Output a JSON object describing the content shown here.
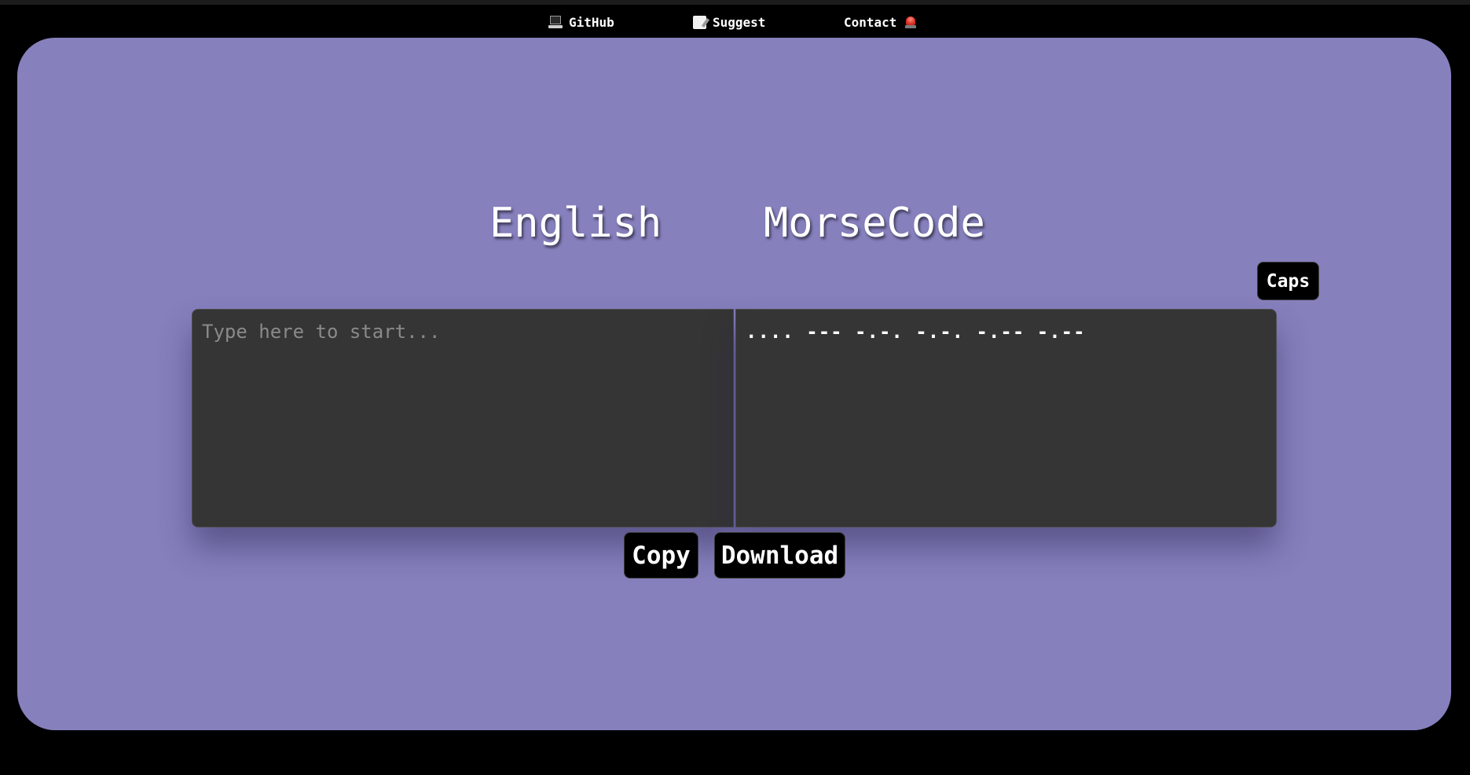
{
  "nav": {
    "items": [
      {
        "label": "GitHub",
        "icon": "laptop-icon"
      },
      {
        "label": "Suggest",
        "icon": "memo-icon"
      },
      {
        "label": "Contact",
        "icon": "siren-icon"
      }
    ]
  },
  "headings": {
    "source": "English",
    "target": "MorseCode"
  },
  "controls": {
    "caps_label": "Caps",
    "copy_label": "Copy",
    "download_label": "Download"
  },
  "english_input": {
    "value": "",
    "placeholder": "Type here to start..."
  },
  "morse_output": {
    "value": ".... --- -.-. -.-. -.-- -.--"
  },
  "colors": {
    "background": "#000000",
    "panel": "#8680bd",
    "textbox": "#353535",
    "button": "#000000",
    "text": "#ffffff"
  }
}
